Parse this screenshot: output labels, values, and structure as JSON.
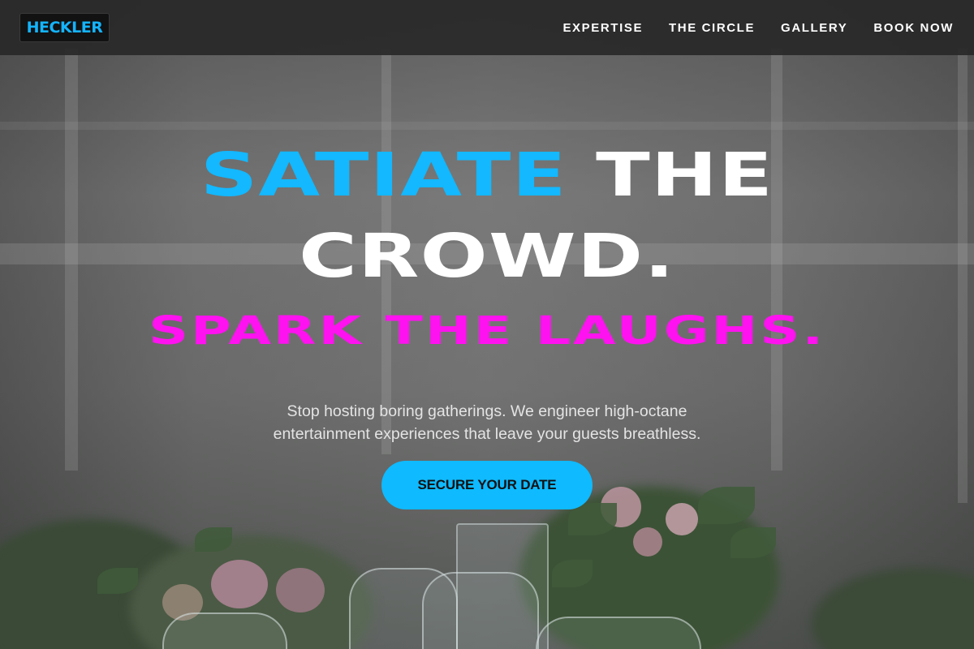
{
  "brand": {
    "logo_text": "HECKLER"
  },
  "nav": {
    "items": [
      {
        "label": "EXPERTISE"
      },
      {
        "label": "THE CIRCLE"
      },
      {
        "label": "GALLERY"
      },
      {
        "label": "BOOK NOW"
      }
    ]
  },
  "hero": {
    "headline_accent": "SATIATE",
    "headline_rest_line1": " THE",
    "headline_line2": "CROWD.",
    "headline_line3": "SPARK THE LAUGHS.",
    "subtext": "Stop hosting boring gatherings. We engineer high-octane entertainment experiences that leave your guests breathless.",
    "cta_label": "SECURE YOUR DATE"
  },
  "colors": {
    "accent_blue": "#13b8ff",
    "accent_magenta": "#ff12f0",
    "header_bg": "#282828"
  }
}
